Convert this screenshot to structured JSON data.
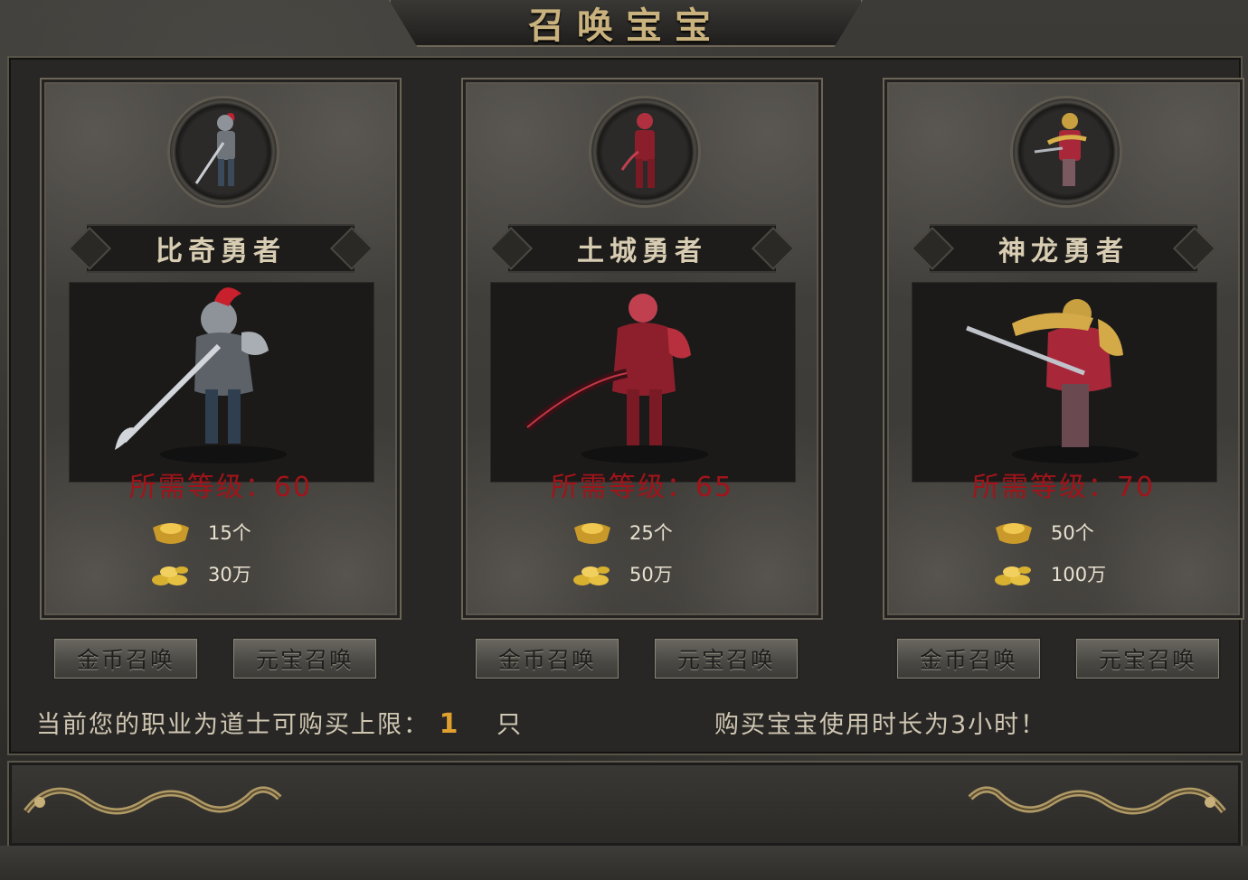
{
  "title": "召唤宝宝",
  "cards": [
    {
      "name": "比奇勇者",
      "requirement": "所需等级：60",
      "ingot_cost": "15个",
      "gold_cost": "30万",
      "gold_button": "金币召唤",
      "ingot_button": "元宝召唤",
      "accent": "#9a9fa6"
    },
    {
      "name": "土城勇者",
      "requirement": "所需等级：65",
      "ingot_cost": "25个",
      "gold_cost": "50万",
      "gold_button": "金币召唤",
      "ingot_button": "元宝召唤",
      "accent": "#b0303a"
    },
    {
      "name": "神龙勇者",
      "requirement": "所需等级：70",
      "ingot_cost": "50个",
      "gold_cost": "100万",
      "gold_button": "金币召唤",
      "ingot_button": "元宝召唤",
      "accent": "#c8a040"
    }
  ],
  "footer": {
    "limit_prefix": "当前您的职业为道士可购买上限：",
    "limit_value": "1",
    "limit_unit": "只",
    "duration_note": "购买宝宝使用时长为3小时！"
  },
  "colors": {
    "requirement": "#a0141a",
    "gold_text": "#c9b27e",
    "limit_value": "#e0a030"
  },
  "icons": {
    "ingot": "gold-ingot-icon",
    "coins": "gold-coins-icon",
    "dragon": "dragon-ornament-icon"
  }
}
